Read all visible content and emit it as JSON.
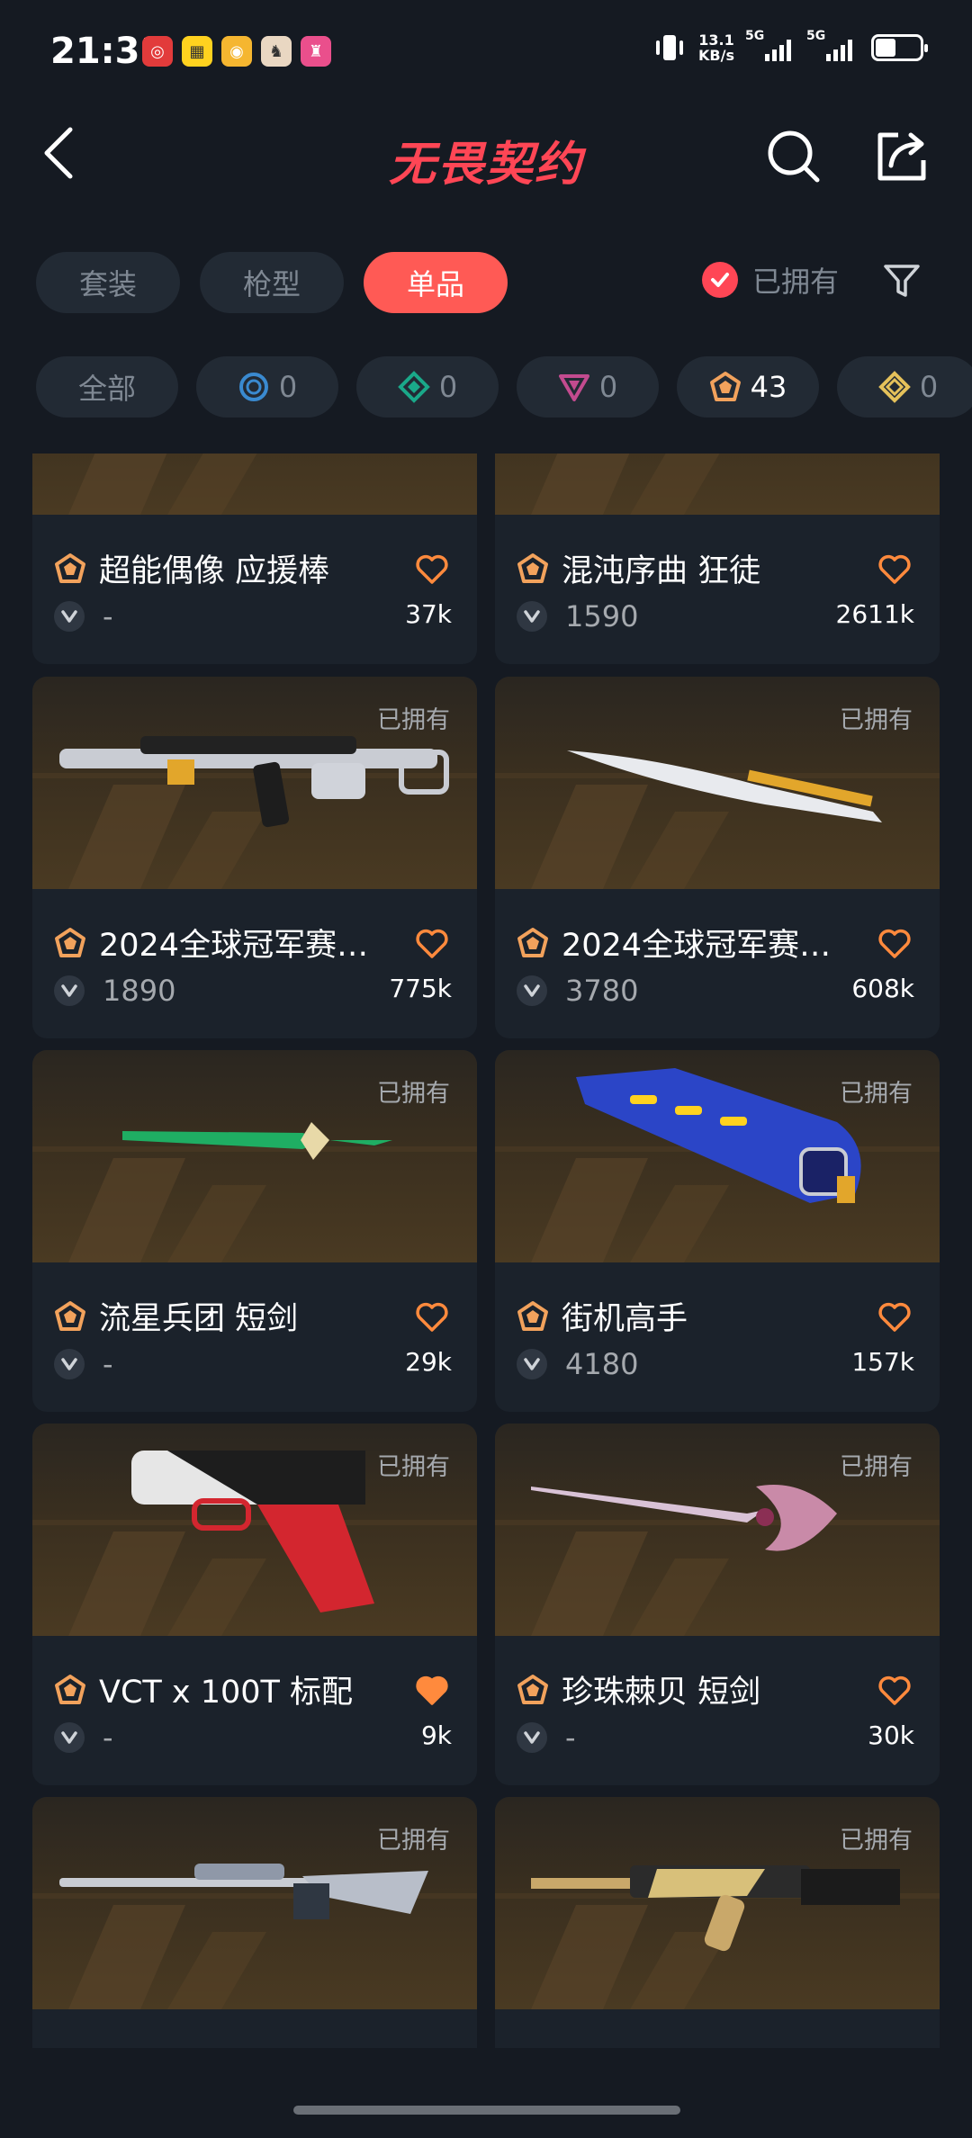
{
  "status": {
    "time": "21:31",
    "net_speed_top": "13.1",
    "net_speed_bottom": "KB/s",
    "sig1": "5G",
    "sig2": "5G",
    "app_icons": [
      "netease-music-icon",
      "tao-icon",
      "qq-music-icon",
      "game-icon-1",
      "game-icon-2"
    ]
  },
  "header": {
    "title": "无畏契约"
  },
  "tabs": [
    {
      "label": "套装",
      "active": false
    },
    {
      "label": "枪型",
      "active": false
    },
    {
      "label": "单品",
      "active": true
    }
  ],
  "owned_filter": {
    "label": "已拥有",
    "checked": true
  },
  "rarity": [
    {
      "label": "全部",
      "icon": "",
      "color": ""
    },
    {
      "label": "0",
      "icon": "select-tier-icon",
      "color": "#3a8ad0"
    },
    {
      "label": "0",
      "icon": "deluxe-tier-icon",
      "color": "#1aa889"
    },
    {
      "label": "0",
      "icon": "premium-tier-icon",
      "color": "#c34b8f"
    },
    {
      "label": "43",
      "icon": "exclusive-tier-icon",
      "color": "#f2a25c"
    },
    {
      "label": "0",
      "icon": "ultra-tier-icon",
      "color": "#e5c15a"
    }
  ],
  "cards": [
    {
      "name": "超能偶像 应援棒",
      "price": "-",
      "likes": "37k",
      "owned": "",
      "liked": false,
      "weapon": "baton"
    },
    {
      "name": "混沌序曲 狂徒",
      "price": "1590",
      "likes": "2611k",
      "owned": "",
      "liked": false,
      "weapon": "rifle-top"
    },
    {
      "name": "2024全球冠军赛…",
      "price": "1890",
      "likes": "775k",
      "owned": "已拥有",
      "liked": false,
      "weapon": "smg"
    },
    {
      "name": "2024全球冠军赛…",
      "price": "3780",
      "likes": "608k",
      "owned": "已拥有",
      "liked": false,
      "weapon": "blade"
    },
    {
      "name": "流星兵团 短剑",
      "price": "-",
      "likes": "29k",
      "owned": "已拥有",
      "liked": false,
      "weapon": "green-sword"
    },
    {
      "name": "街机高手",
      "price": "4180",
      "likes": "157k",
      "owned": "已拥有",
      "liked": false,
      "weapon": "arcade"
    },
    {
      "name": "VCT x 100T 标配",
      "price": "-",
      "likes": "9k",
      "owned": "已拥有",
      "liked": true,
      "weapon": "pistol"
    },
    {
      "name": "珍珠棘贝 短剑",
      "price": "-",
      "likes": "30k",
      "owned": "已拥有",
      "liked": false,
      "weapon": "pearl-sword"
    },
    {
      "name": "",
      "price": "",
      "likes": "",
      "owned": "已拥有",
      "liked": false,
      "weapon": "sniper"
    },
    {
      "name": "",
      "price": "",
      "likes": "",
      "owned": "已拥有",
      "liked": false,
      "weapon": "ak"
    }
  ]
}
